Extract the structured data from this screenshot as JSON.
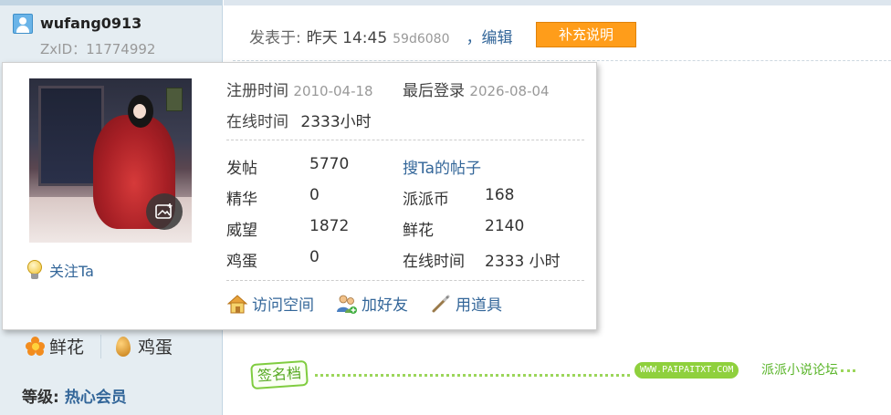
{
  "author": {
    "username": "wufang0913",
    "zxid": "ZxID：11774992",
    "flower_label": "鲜花",
    "egg_label": "鸡蛋",
    "level_label": "等级:",
    "level_value": "热心会员"
  },
  "post": {
    "posted_label": "发表于:",
    "time": "昨天 14:45",
    "ip": "59d6080",
    "edit_label": "，编辑",
    "supplement_button": "补充说明"
  },
  "signature": {
    "badge": "签名档",
    "site": "WWW.PAIPAITXT.COM",
    "forum": "派派小说论坛"
  },
  "popup": {
    "follow_label": "关注Ta",
    "reg_label": "注册时间",
    "reg_value": "2010-04-18",
    "last_login_label": "最后登录",
    "last_login_value": "2026-08-04",
    "online_label": "在线时间",
    "online_value": "2333小时",
    "stats": {
      "posts_label": "发帖",
      "posts_value": "5770",
      "search_link": "搜Ta的帖子",
      "digest_label": "精华",
      "digest_value": "0",
      "coins_label": "派派币",
      "coins_value": "168",
      "prestige_label": "威望",
      "prestige_value": "1872",
      "flower_label": "鲜花",
      "flower_value": "2140",
      "egg_label": "鸡蛋",
      "egg_value": "0",
      "online_label": "在线时间",
      "online_value": "2333 小时"
    },
    "actions": {
      "visit": "访问空间",
      "add_friend": "加好友",
      "use_tool": "用道具"
    }
  },
  "colors": {
    "link": "#336699",
    "supplement_button_bg": "#ff9d1a",
    "sidebar_bg": "#e5edf2"
  }
}
